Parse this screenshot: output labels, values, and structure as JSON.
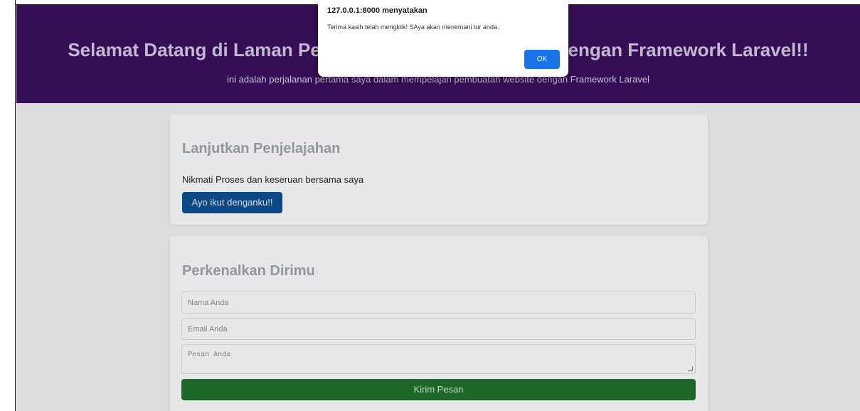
{
  "hero": {
    "title": "Selamat Datang di Laman Pertama Pembuatan Website dengan Framework Laravel!!",
    "subtitle": "ini adalah perjalanan pertama saya dalam mempelajari pembuatan website dengan Framework Laravel"
  },
  "explore": {
    "heading": "Lanjutkan Penjelajahan",
    "text": "Nikmati Proses dan keseruan bersama saya",
    "button_label": "Ayo ikut denganku!!"
  },
  "intro_form": {
    "heading": "Perkenalkan Dirimu",
    "name_placeholder": "Nama Anda",
    "email_placeholder": "Email Anda",
    "message_placeholder": "Pesan Anda",
    "submit_label": "Kirim Pesan"
  },
  "alert": {
    "title": "127.0.0.1:8000 menyatakan",
    "message": "Terima kasih telah mengklik! SAya akan menemani tur anda.",
    "ok_label": "OK"
  },
  "colors": {
    "hero_background": "#3a0f5c",
    "primary_button": "#0b4d8f",
    "submit_button": "#1f6f2b",
    "dialog_ok": "#1a73e8"
  }
}
